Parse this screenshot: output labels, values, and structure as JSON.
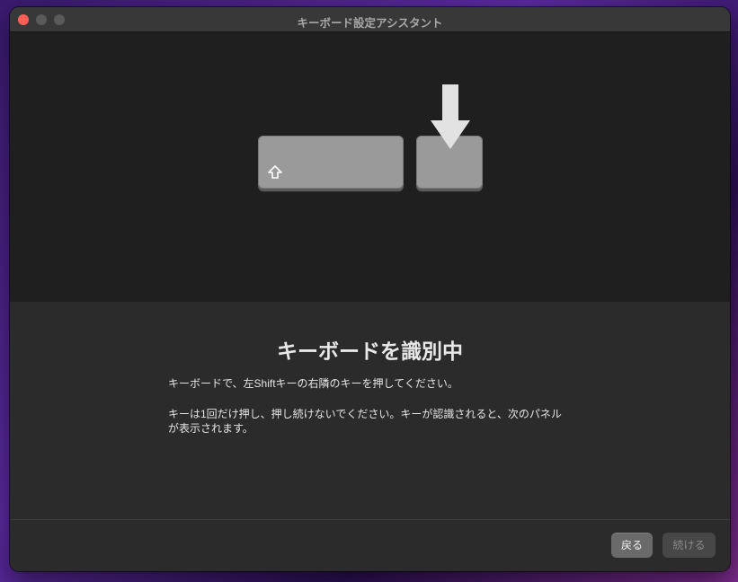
{
  "window": {
    "title": "キーボード設定アシスタント"
  },
  "illustration": {
    "shift_key_icon": "shift-arrow-icon",
    "arrow_icon": "down-arrow-icon"
  },
  "content": {
    "heading": "キーボードを識別中",
    "instruction": "キーボードで、左Shiftキーの右隣のキーを押してください。",
    "note_line1": "キーは1回だけ押し、押し続けないでください。キーが認識されると、次のパネル",
    "note_line2": "が表示されます。"
  },
  "footer": {
    "back_label": "戻る",
    "continue_label": "続ける"
  },
  "colors": {
    "close": "#ff5f57",
    "window_bg": "#2b2b2b",
    "illustration_bg": "#1f1f1f",
    "key": "#9a9a9a"
  }
}
